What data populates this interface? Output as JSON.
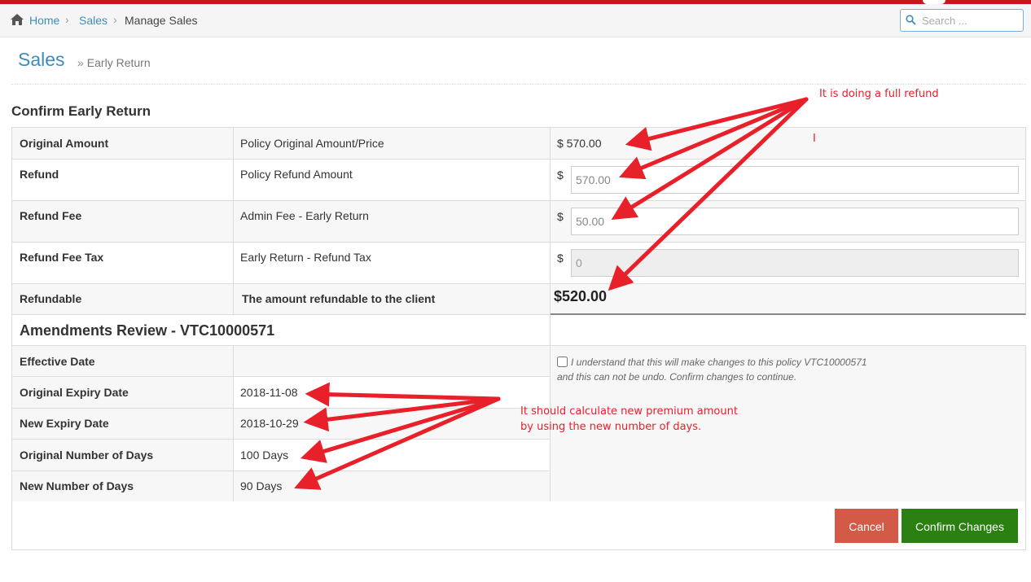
{
  "breadcrumb": {
    "home": "Home",
    "sales": "Sales",
    "current": "Manage Sales",
    "separator": "›"
  },
  "search": {
    "placeholder": "Search ..."
  },
  "page": {
    "title": "Sales",
    "subtitle": "Early Return",
    "subtitle_prefix": "»"
  },
  "confirm_section": {
    "heading": "Confirm Early Return",
    "rows": [
      {
        "label": "Original Amount",
        "description": "Policy Original Amount/Price",
        "value": "$ 570.00"
      },
      {
        "label": "Refund",
        "description": "Policy Refund Amount",
        "currency": "$",
        "input_value": "570.00"
      },
      {
        "label": "Refund Fee",
        "description": "Admin Fee - Early Return",
        "currency": "$",
        "input_value": "50.00"
      },
      {
        "label": "Refund Fee Tax",
        "description": "Early Return - Refund Tax",
        "currency": "$",
        "input_value": "0"
      },
      {
        "label": "Refundable",
        "description": "The amount refundable to the client",
        "value": "$520.00"
      }
    ]
  },
  "amendments": {
    "heading": "Amendments Review - VTC10000571",
    "rows": [
      {
        "label": "Effective Date",
        "value": ""
      },
      {
        "label": "Original Expiry Date",
        "value": "2018-11-08"
      },
      {
        "label": "New Expiry Date",
        "value": "2018-10-29"
      },
      {
        "label": "Original Number of Days",
        "value": "100 Days"
      },
      {
        "label": "New Number of Days",
        "value": "90 Days"
      }
    ],
    "confirm_line1": "I understand that this will make changes to this policy VTC10000571",
    "confirm_line2": "and this can not be undo. Confirm changes to continue."
  },
  "buttons": {
    "cancel": "Cancel",
    "confirm": "Confirm Changes"
  },
  "annotations": {
    "top_note": "It is doing a full refund",
    "cursor_mark": "I",
    "bottom_note_line1": "It should calculate new premium amount",
    "bottom_note_line2": "by using the new number of days."
  },
  "colors": {
    "brand_red": "#c9151b",
    "link_blue": "#3c8dbc",
    "cancel_button": "#d45a48",
    "confirm_button": "#2a8111",
    "annotation_red": "#e8202a"
  },
  "icons": {
    "home": "home-icon",
    "search": "search-icon",
    "arrows": "annotation-arrow"
  }
}
